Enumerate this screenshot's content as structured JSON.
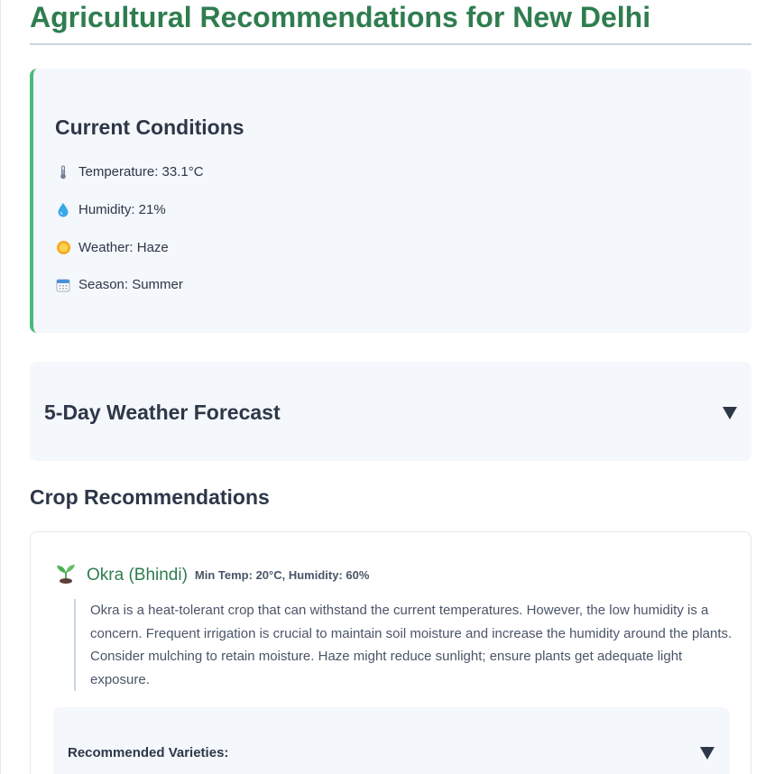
{
  "page": {
    "title": "Agricultural Recommendations for New Delhi"
  },
  "conditions": {
    "heading": "Current Conditions",
    "items": [
      {
        "icon": "thermometer-icon",
        "text": "Temperature: 33.1°C"
      },
      {
        "icon": "droplet-icon",
        "text": "Humidity: 21%"
      },
      {
        "icon": "sun-icon",
        "text": "Weather: Haze"
      },
      {
        "icon": "calendar-icon",
        "text": "Season: Summer"
      }
    ]
  },
  "forecast": {
    "heading": "5-Day Weather Forecast"
  },
  "crops": {
    "heading": "Crop Recommendations",
    "items": [
      {
        "icon": "seedling-icon",
        "name": "Okra (Bhindi)",
        "meta": "Min Temp: 20°C, Humidity: 60%",
        "description": "Okra is a heat-tolerant crop that can withstand the current temperatures. However, the low humidity is a concern. Frequent irrigation is crucial to maintain soil moisture and increase the humidity around the plants. Consider mulching to retain moisture. Haze might reduce sunlight; ensure plants get adequate light exposure.",
        "varieties_label": "Recommended Varieties:"
      }
    ]
  },
  "colors": {
    "accent_green": "#2f7d4f",
    "border_green": "#48bb78",
    "panel_bg": "#f4f7fb"
  }
}
